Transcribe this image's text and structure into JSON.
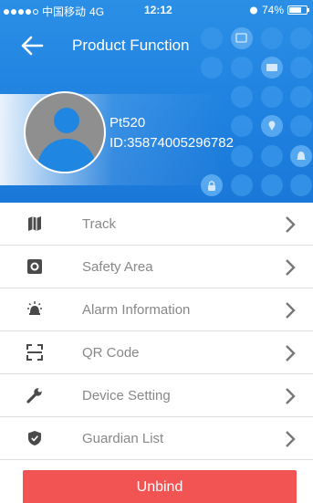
{
  "status_bar": {
    "carrier": "中国移动",
    "network": "4G",
    "time": "12:12",
    "battery": "74%",
    "battery_level": 0.74
  },
  "header": {
    "title": "Product Function",
    "back_icon": "back-arrow-icon"
  },
  "device": {
    "name": "Pt520",
    "id": "ID:35874005296782"
  },
  "menu": {
    "items": [
      {
        "label": "Track",
        "icon": "map-icon"
      },
      {
        "label": "Safety Area",
        "icon": "safety-area-icon"
      },
      {
        "label": "Alarm Information",
        "icon": "alarm-icon"
      },
      {
        "label": "QR Code",
        "icon": "qr-code-icon"
      },
      {
        "label": "Device Setting",
        "icon": "wrench-icon"
      },
      {
        "label": "Guardian List",
        "icon": "shield-icon"
      }
    ]
  },
  "unbind_label": "Unbind",
  "colors": {
    "header_blue": "#1e80df",
    "unbind_red": "#f25454",
    "label_gray": "#888888"
  }
}
